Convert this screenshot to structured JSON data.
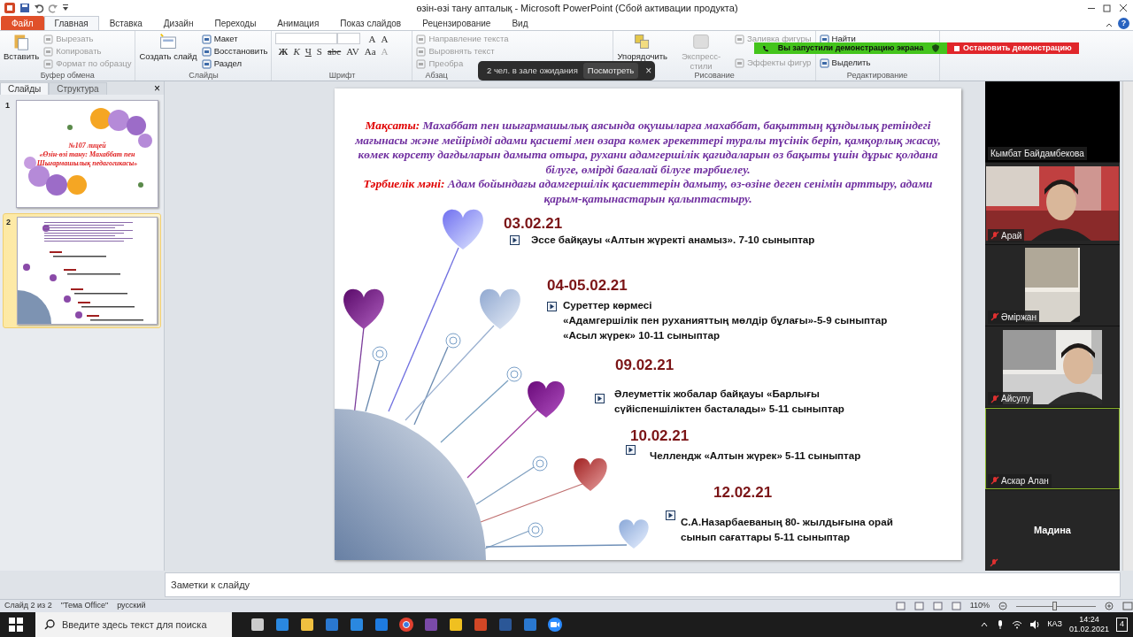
{
  "window": {
    "title": "өзін-өзі тану апталық  -  Microsoft PowerPoint (Сбой активации продукта)",
    "help": "?"
  },
  "ribbon": {
    "tabs": [
      {
        "label": "Файл",
        "kind": "file",
        "selected": false
      },
      {
        "label": "Главная",
        "kind": "tab",
        "selected": true
      },
      {
        "label": "Вставка",
        "kind": "tab",
        "selected": false
      },
      {
        "label": "Дизайн",
        "kind": "tab",
        "selected": false
      },
      {
        "label": "Переходы",
        "kind": "tab",
        "selected": false
      },
      {
        "label": "Анимация",
        "kind": "tab",
        "selected": false
      },
      {
        "label": "Показ слайдов",
        "kind": "tab",
        "selected": false
      },
      {
        "label": "Рецензирование",
        "kind": "tab",
        "selected": false
      },
      {
        "label": "Вид",
        "kind": "tab",
        "selected": false
      }
    ],
    "groups": [
      {
        "label": "Буфер обмена",
        "commands": [
          {
            "label": "Вставить",
            "kind": "large",
            "disabled": false
          },
          {
            "label": "Вырезать",
            "kind": "small",
            "disabled": true
          },
          {
            "label": "Копировать",
            "kind": "small",
            "disabled": true
          },
          {
            "label": "Формат по образцу",
            "kind": "small",
            "disabled": true
          }
        ]
      },
      {
        "label": "Слайды",
        "commands": [
          {
            "label": "Создать слайд",
            "kind": "large",
            "disabled": false
          },
          {
            "label": "Макет",
            "kind": "small",
            "disabled": false
          },
          {
            "label": "Восстановить",
            "kind": "small",
            "disabled": false
          },
          {
            "label": "Раздел",
            "kind": "small",
            "disabled": false
          }
        ]
      },
      {
        "label": "Шрифт",
        "commands": [
          {
            "label": "A",
            "kind": "glyph",
            "disabled": false
          },
          {
            "label": "A",
            "kind": "glyph",
            "disabled": false
          },
          {
            "label": "Ж",
            "kind": "glyph",
            "disabled": false
          },
          {
            "label": "К",
            "kind": "glyph",
            "disabled": false
          },
          {
            "label": "Ч",
            "kind": "glyph",
            "disabled": false
          },
          {
            "label": "S",
            "kind": "glyph",
            "disabled": false
          },
          {
            "label": "abc",
            "kind": "glyph",
            "disabled": false
          },
          {
            "label": "AV",
            "kind": "glyph",
            "disabled": false
          },
          {
            "label": "Aa",
            "kind": "glyph",
            "disabled": false
          },
          {
            "label": "A",
            "kind": "glyph",
            "disabled": true
          }
        ]
      },
      {
        "label": "Абзац",
        "commands": [
          {
            "label": "Направление текста",
            "kind": "small",
            "disabled": true
          },
          {
            "label": "Выровнять текст",
            "kind": "small",
            "disabled": true
          },
          {
            "label": "Преобра",
            "kind": "small",
            "disabled": true
          }
        ]
      },
      {
        "label": "Рисование",
        "commands": [
          {
            "label": "Упорядочить",
            "kind": "large",
            "disabled": false
          },
          {
            "label": "Экспресс-стили",
            "kind": "large",
            "disabled": true
          },
          {
            "label": "Заливка фигуры",
            "kind": "small",
            "disabled": true
          },
          {
            "label": "Эффекты фигур",
            "kind": "small",
            "disabled": true
          }
        ]
      },
      {
        "label": "Редактирование",
        "commands": [
          {
            "label": "Найти",
            "kind": "small",
            "disabled": false
          },
          {
            "label": "Выделить",
            "kind": "small",
            "disabled": false
          }
        ]
      }
    ]
  },
  "waiting_toast": {
    "text": "2 чел. в зале ожидания",
    "action": "Посмотреть",
    "close": "×"
  },
  "share_banner": {
    "text": "Вы запустили демонстрацию экрана",
    "stop": "Остановить демонстрацию"
  },
  "panel": {
    "tabs": [
      {
        "label": "Слайды",
        "selected": true
      },
      {
        "label": "Структура",
        "selected": false
      }
    ],
    "close": "×",
    "thumbnails": [
      {
        "number": "1",
        "selected": false,
        "kind": "title",
        "lines": [
          "№107 лицей",
          "«Өзін-өзі тану: Махаббат пен",
          "Шығармашылық  педагогикасы»"
        ]
      },
      {
        "number": "2",
        "selected": true,
        "kind": "content"
      }
    ]
  },
  "slide": {
    "goal_label": "Мақсаты:",
    "goal": "Махаббат пен шығармашылық аясында  оқушыларға махаббат, бақыттың құндылық ретіндегі мағынасы және мейірімді адами қасиеті мен  өзара көмек әрекеттері туралы түсінік беріп, қамқорлық жасау, көмек көрсету дағдыларын дамыта отыра, рухани адамгершілік қағидаларын өз бақыты үшін дұрыс қолдана білуге,  өмірді бағалай білуге тәрбиелеу.",
    "value_label": "Тәрбиелік мәні:",
    "value": "Адам бойындағы адамгершілік қасиеттерін дамыту, өз-өзіне деген  сенімін арттыру, адами қарым-қатынастарын қалыптастыру.",
    "events": [
      {
        "date": "03.02.21",
        "lines": [
          "Эссе байқауы «Алтын жүректі анамыз». 7-10 сыныптар"
        ]
      },
      {
        "date": "04-05.02.21",
        "lines": [
          "Суреттер көрмесі",
          "«Адамгершілік пен руханияттың мөлдір бұлағы»-5-9 сыныптар",
          "«Асыл жүрек» 10-11 сыныптар"
        ]
      },
      {
        "date": "09.02.21",
        "lines": [
          "Әлеуметтік жобалар  байқауы «Барлығы сүйіспеншіліктен басталады» 5-11 сыныптар"
        ]
      },
      {
        "date": "10.02.21",
        "lines": [
          "Челлендж «Алтын жүрек» 5-11 сыныптар"
        ]
      },
      {
        "date": "12.02.21",
        "lines": [
          "С.А.Назарбаеваның 80- жылдығына орай сынып сағаттары 5-11 сыныптар"
        ]
      }
    ]
  },
  "participants": [
    {
      "name": "Кымбат Байдамбекова",
      "kind": "blank",
      "muted": false,
      "speaking": false
    },
    {
      "name": "Арай",
      "kind": "video",
      "muted": true,
      "speaking": false
    },
    {
      "name": "Әміржан",
      "kind": "video",
      "muted": true,
      "speaking": false
    },
    {
      "name": "Айсулу",
      "kind": "video",
      "muted": true,
      "speaking": false
    },
    {
      "name": "Аскар Алан",
      "kind": "blank",
      "muted": true,
      "speaking": true
    },
    {
      "name": "Мадина",
      "kind": "name",
      "muted": true,
      "speaking": false
    }
  ],
  "notes": {
    "placeholder": "Заметки к слайду"
  },
  "status_bar": {
    "slide": "Слайд 2 из 2",
    "theme": "\"Тема Office\"",
    "language": "русский",
    "zoom": "110%",
    "level": 0.45
  },
  "taskbar": {
    "search_placeholder": "Введите здесь текст для поиска",
    "language": "КАЗ",
    "time": "14:24",
    "date": "01.02.2021",
    "notifications": "4"
  }
}
